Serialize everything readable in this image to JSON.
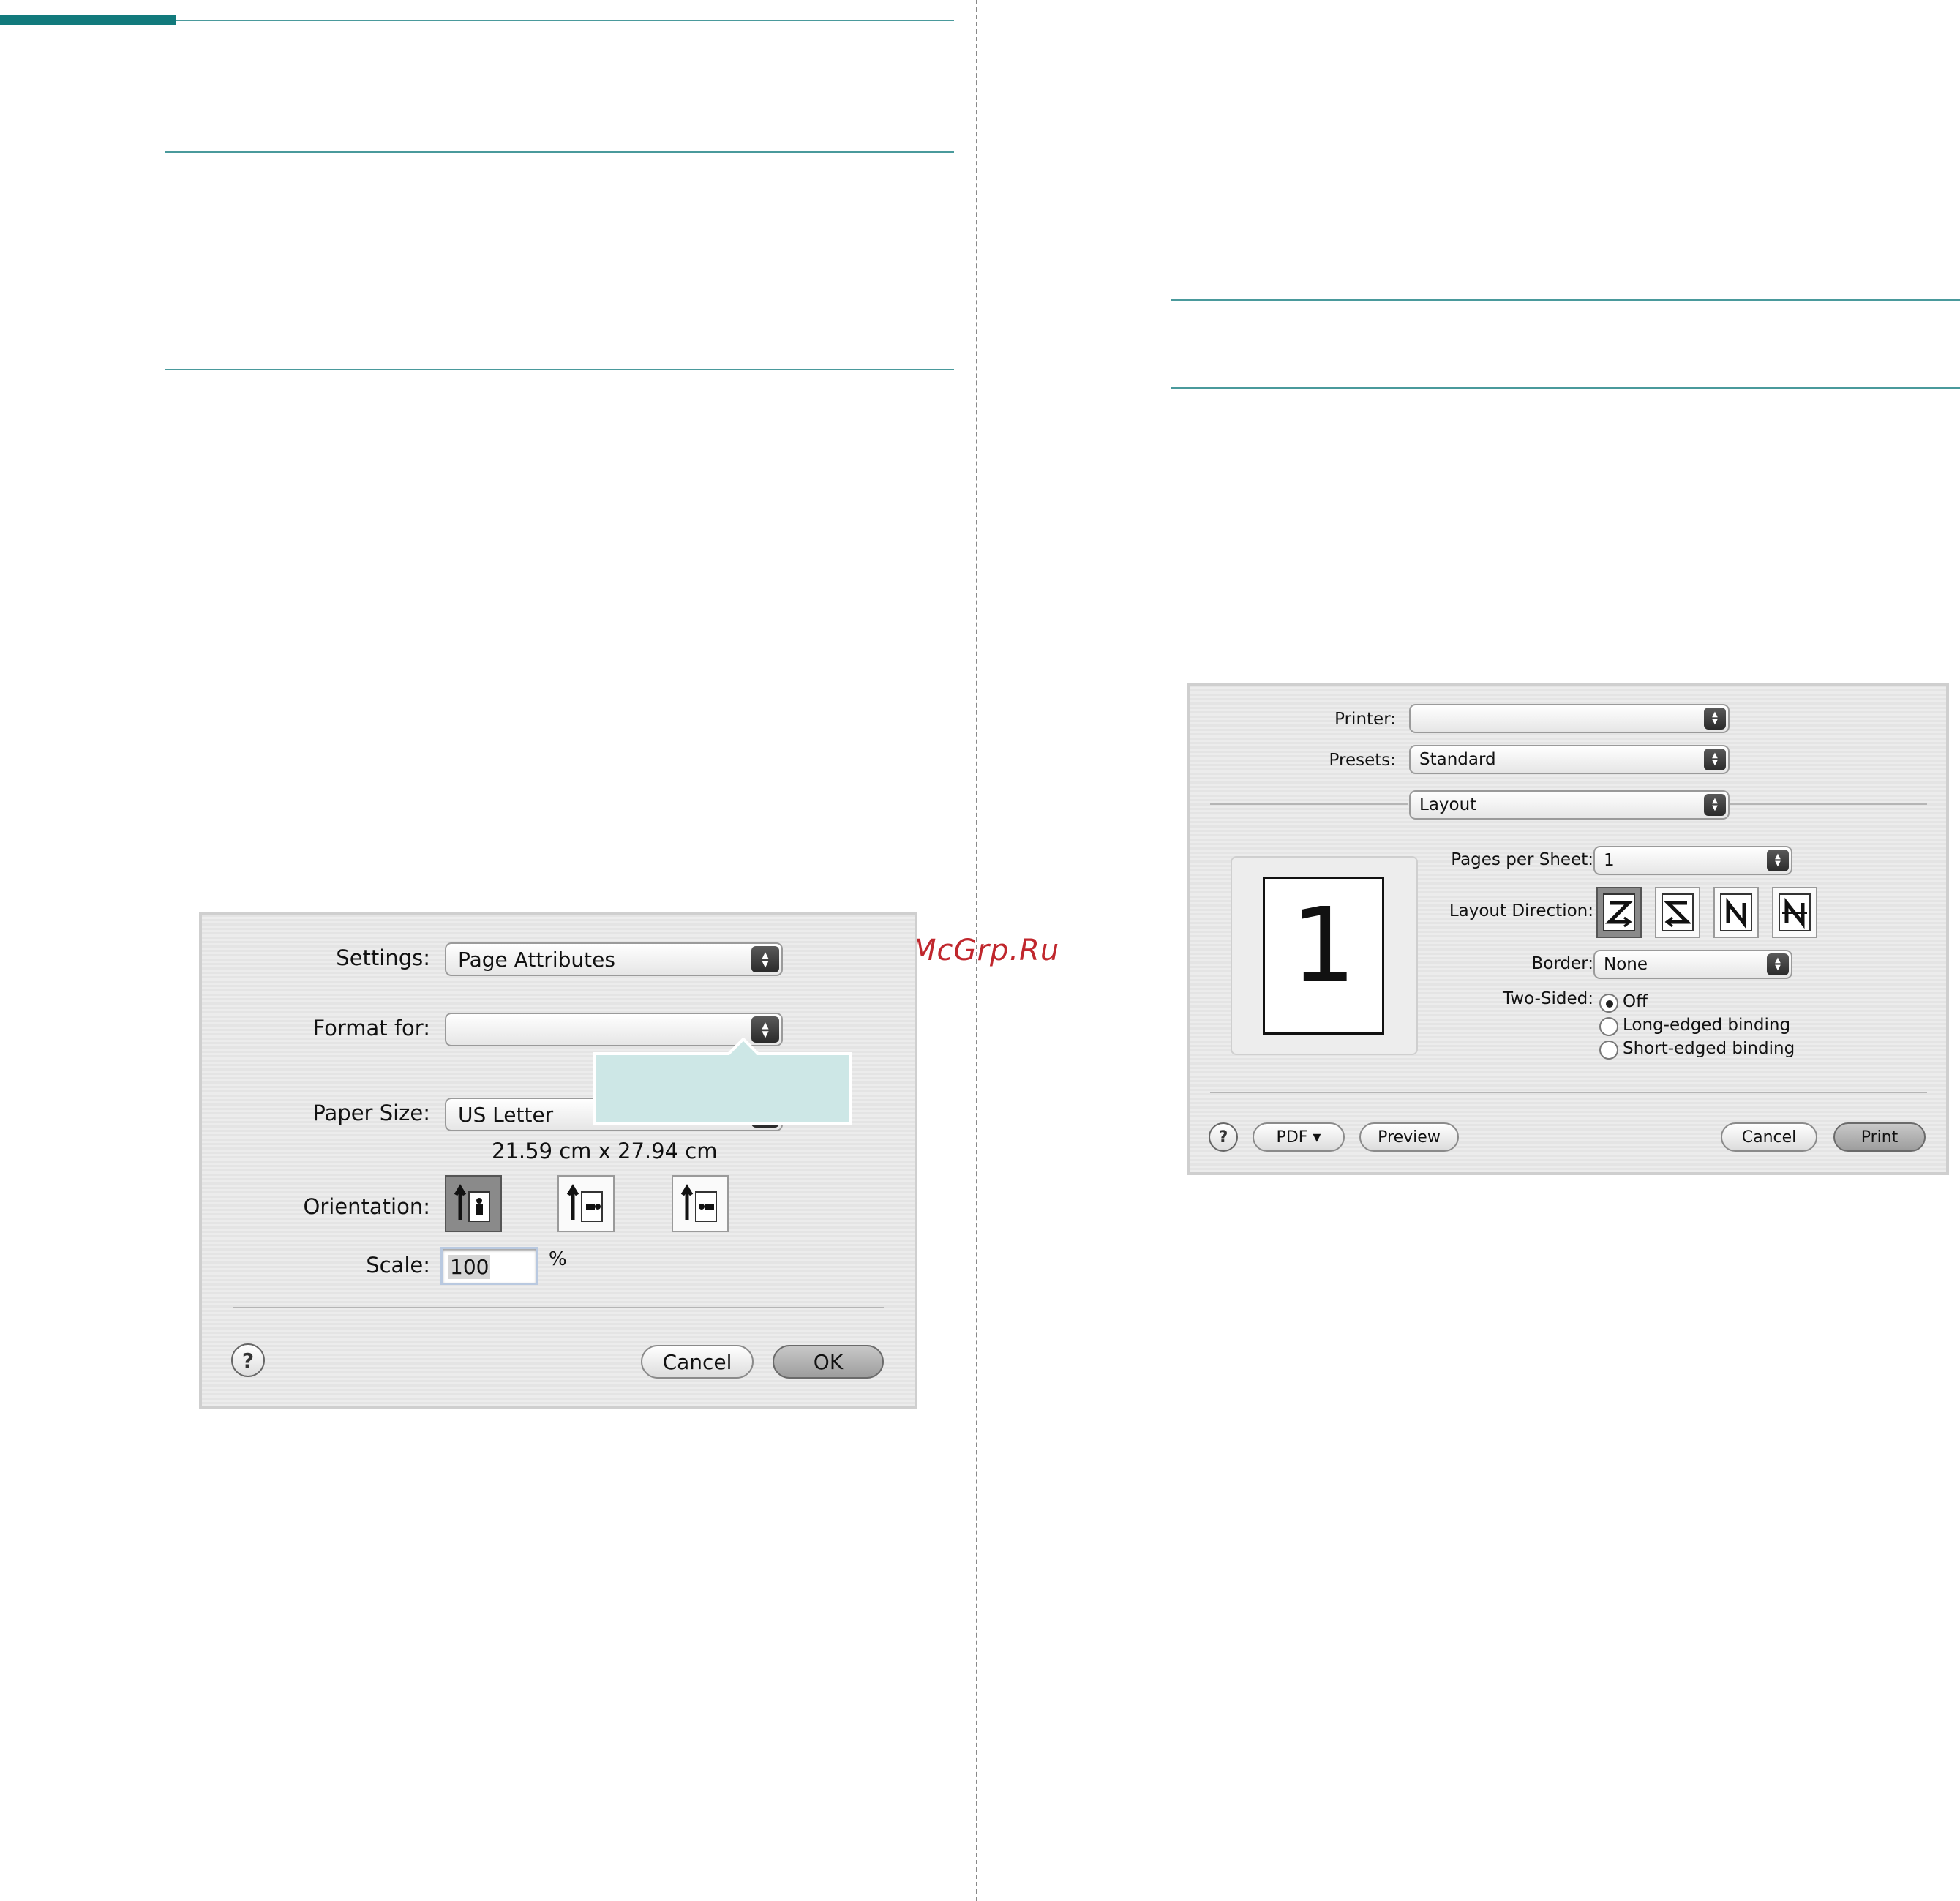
{
  "watermark": "McGrp.Ru",
  "page_setup_dialog": {
    "settings_label": "Settings:",
    "settings_value": "Page Attributes",
    "format_for_label": "Format for:",
    "format_for_value": "",
    "paper_size_label": "Paper Size:",
    "paper_size_value": "US Letter",
    "paper_dimensions": "21.59 cm x 27.94 cm",
    "orientation_label": "Orientation:",
    "orientation_options": [
      "portrait-icon",
      "landscape-left-icon",
      "landscape-right-icon"
    ],
    "orientation_selected": 0,
    "scale_label": "Scale:",
    "scale_value": "100",
    "scale_unit": "%",
    "help_label": "?",
    "cancel_label": "Cancel",
    "ok_label": "OK",
    "callout_color": "#cde7e6"
  },
  "print_dialog": {
    "printer_label": "Printer:",
    "printer_value": "",
    "presets_label": "Presets:",
    "presets_value": "Standard",
    "panel_value": "Layout",
    "preview_page_number": "1",
    "pages_per_sheet_label": "Pages per Sheet:",
    "pages_per_sheet_value": "1",
    "layout_direction_label": "Layout Direction:",
    "layout_direction_options": [
      "z-left-right-icon",
      "s-right-left-icon",
      "n-top-bottom-left-icon",
      "n-top-bottom-right-icon"
    ],
    "layout_direction_selected": 0,
    "border_label": "Border:",
    "border_value": "None",
    "two_sided_label": "Two-Sided:",
    "two_sided_options": [
      "Off",
      "Long-edged binding",
      "Short-edged binding"
    ],
    "two_sided_selected": 0,
    "help_label": "?",
    "pdf_label": "PDF ▾",
    "preview_label": "Preview",
    "cancel_label": "Cancel",
    "print_label": "Print"
  },
  "colors": {
    "accent_teal": "#127a7c",
    "rule_teal": "#4a9a9c",
    "watermark_red": "#c0272d"
  }
}
